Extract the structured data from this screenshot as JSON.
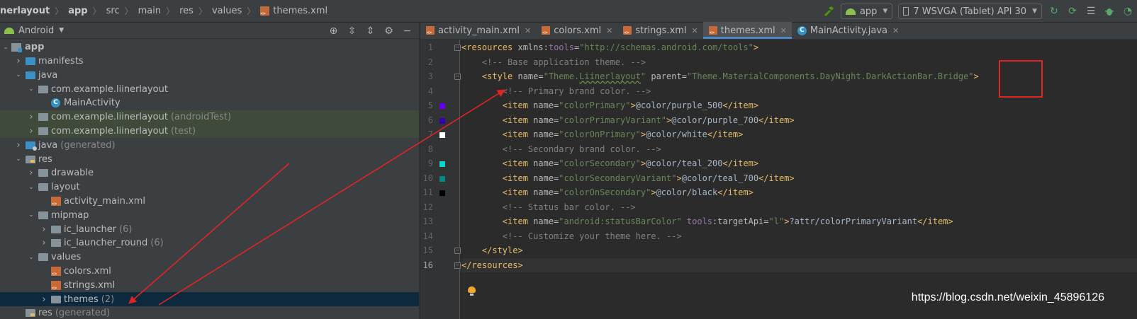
{
  "breadcrumb": [
    "nerlayout",
    "app",
    "src",
    "main",
    "res",
    "values",
    "themes.xml"
  ],
  "toolbar": {
    "config_label": "app",
    "device_label": "7  WSVGA (Tablet) API 30",
    "colors": {
      "hammer": "#4e9a06",
      "android": "#8cbf4d",
      "debug": "#59a869"
    }
  },
  "project": {
    "view_label": "Android",
    "tree": [
      {
        "label": "app",
        "extra": "",
        "depth": 0,
        "arrow": "open",
        "icon": "app",
        "bold": true
      },
      {
        "label": "manifests",
        "extra": "",
        "depth": 1,
        "arrow": "closed",
        "icon": "folder-blue"
      },
      {
        "label": "java",
        "extra": "",
        "depth": 1,
        "arrow": "open",
        "icon": "folder-blue"
      },
      {
        "label": "com.example.liinerlayout",
        "extra": "",
        "depth": 2,
        "arrow": "open",
        "icon": "pkg"
      },
      {
        "label": "MainActivity",
        "extra": "",
        "depth": 3,
        "arrow": "none",
        "icon": "class"
      },
      {
        "label": "com.example.liinerlayout",
        "extra": "(androidTest)",
        "depth": 2,
        "arrow": "closed",
        "icon": "pkg",
        "row": "hl-green"
      },
      {
        "label": "com.example.liinerlayout",
        "extra": "(test)",
        "depth": 2,
        "arrow": "closed",
        "icon": "pkg",
        "row": "hl-green"
      },
      {
        "label": "java",
        "extra": "(generated)",
        "depth": 1,
        "arrow": "closed",
        "icon": "folder-gen"
      },
      {
        "label": "res",
        "extra": "",
        "depth": 1,
        "arrow": "open",
        "icon": "res"
      },
      {
        "label": "drawable",
        "extra": "",
        "depth": 2,
        "arrow": "closed",
        "icon": "pkg"
      },
      {
        "label": "layout",
        "extra": "",
        "depth": 2,
        "arrow": "open",
        "icon": "pkg"
      },
      {
        "label": "activity_main.xml",
        "extra": "",
        "depth": 3,
        "arrow": "none",
        "icon": "xml"
      },
      {
        "label": "mipmap",
        "extra": "",
        "depth": 2,
        "arrow": "open",
        "icon": "pkg"
      },
      {
        "label": "ic_launcher",
        "extra": "(6)",
        "depth": 3,
        "arrow": "closed",
        "icon": "pkg"
      },
      {
        "label": "ic_launcher_round",
        "extra": "(6)",
        "depth": 3,
        "arrow": "closed",
        "icon": "pkg"
      },
      {
        "label": "values",
        "extra": "",
        "depth": 2,
        "arrow": "open",
        "icon": "pkg"
      },
      {
        "label": "colors.xml",
        "extra": "",
        "depth": 3,
        "arrow": "none",
        "icon": "xml"
      },
      {
        "label": "strings.xml",
        "extra": "",
        "depth": 3,
        "arrow": "none",
        "icon": "xml"
      },
      {
        "label": "themes",
        "extra": "(2)",
        "depth": 3,
        "arrow": "closed",
        "icon": "pkg",
        "row": "sel"
      },
      {
        "label": "res",
        "extra": "(generated)",
        "depth": 1,
        "arrow": "none",
        "icon": "res"
      }
    ]
  },
  "editor": {
    "tabs": [
      {
        "label": "activity_main.xml",
        "icon": "xml",
        "active": false
      },
      {
        "label": "colors.xml",
        "icon": "xml",
        "active": false
      },
      {
        "label": "strings.xml",
        "icon": "xml",
        "active": false
      },
      {
        "label": "themes.xml",
        "icon": "xml",
        "active": true
      },
      {
        "label": "MainActivity.java",
        "icon": "class",
        "active": false
      }
    ],
    "current_line": 16,
    "swatches": [
      {
        "line": 5,
        "color": "#6200ee"
      },
      {
        "line": 6,
        "color": "#3700b3"
      },
      {
        "line": 7,
        "color": "#ffffff"
      },
      {
        "line": 9,
        "color": "#03dac5"
      },
      {
        "line": 10,
        "color": "#018786"
      },
      {
        "line": 11,
        "color": "#000000"
      }
    ],
    "lines": [
      [
        [
          "t-tag",
          "<resources "
        ],
        [
          "t-attr",
          "xmlns:"
        ],
        [
          "t-ns",
          "tools"
        ],
        [
          "t-attr",
          "="
        ],
        [
          "t-val",
          "\"http://schemas.android.com/tools\""
        ],
        [
          "t-tag",
          ">"
        ]
      ],
      [
        [
          "t-txt",
          "    "
        ],
        [
          "t-com",
          "<!-- Base application theme. -->"
        ]
      ],
      [
        [
          "t-txt",
          "    "
        ],
        [
          "t-tag",
          "<style "
        ],
        [
          "t-attr",
          "name="
        ],
        [
          "t-val",
          "\"Theme."
        ],
        [
          "t-val t-warn",
          "Liinerlayout"
        ],
        [
          "t-val",
          "\" "
        ],
        [
          "t-attr",
          "parent="
        ],
        [
          "t-val",
          "\"Theme.MaterialComponents.DayNight.DarkActionBar.Bridge\""
        ],
        [
          "t-tag",
          ">"
        ]
      ],
      [
        [
          "t-txt",
          "        "
        ],
        [
          "t-com",
          "<!-- Primary brand color. -->"
        ]
      ],
      [
        [
          "t-txt",
          "        "
        ],
        [
          "t-tag",
          "<item "
        ],
        [
          "t-attr",
          "name="
        ],
        [
          "t-val",
          "\"colorPrimary\""
        ],
        [
          "t-tag",
          ">"
        ],
        [
          "t-txt",
          "@color/purple_500"
        ],
        [
          "t-tag",
          "</item>"
        ]
      ],
      [
        [
          "t-txt",
          "        "
        ],
        [
          "t-tag",
          "<item "
        ],
        [
          "t-attr",
          "name="
        ],
        [
          "t-val",
          "\"colorPrimaryVariant\""
        ],
        [
          "t-tag",
          ">"
        ],
        [
          "t-txt",
          "@color/purple_700"
        ],
        [
          "t-tag",
          "</item>"
        ]
      ],
      [
        [
          "t-txt",
          "        "
        ],
        [
          "t-tag",
          "<item "
        ],
        [
          "t-attr",
          "name="
        ],
        [
          "t-val",
          "\"colorOnPrimary\""
        ],
        [
          "t-tag",
          ">"
        ],
        [
          "t-txt",
          "@color/white"
        ],
        [
          "t-tag",
          "</item>"
        ]
      ],
      [
        [
          "t-txt",
          "        "
        ],
        [
          "t-com",
          "<!-- Secondary brand color. -->"
        ]
      ],
      [
        [
          "t-txt",
          "        "
        ],
        [
          "t-tag",
          "<item "
        ],
        [
          "t-attr",
          "name="
        ],
        [
          "t-val",
          "\"colorSecondary\""
        ],
        [
          "t-tag",
          ">"
        ],
        [
          "t-txt",
          "@color/teal_200"
        ],
        [
          "t-tag",
          "</item>"
        ]
      ],
      [
        [
          "t-txt",
          "        "
        ],
        [
          "t-tag",
          "<item "
        ],
        [
          "t-attr",
          "name="
        ],
        [
          "t-val",
          "\"colorSecondaryVariant\""
        ],
        [
          "t-tag",
          ">"
        ],
        [
          "t-txt",
          "@color/teal_700"
        ],
        [
          "t-tag",
          "</item>"
        ]
      ],
      [
        [
          "t-txt",
          "        "
        ],
        [
          "t-tag",
          "<item "
        ],
        [
          "t-attr",
          "name="
        ],
        [
          "t-val",
          "\"colorOnSecondary\""
        ],
        [
          "t-tag",
          ">"
        ],
        [
          "t-txt",
          "@color/black"
        ],
        [
          "t-tag",
          "</item>"
        ]
      ],
      [
        [
          "t-txt",
          "        "
        ],
        [
          "t-com",
          "<!-- Status bar color. -->"
        ]
      ],
      [
        [
          "t-txt",
          "        "
        ],
        [
          "t-tag",
          "<item "
        ],
        [
          "t-attr",
          "name="
        ],
        [
          "t-val",
          "\"android:statusBarColor\" "
        ],
        [
          "t-ns",
          "tools"
        ],
        [
          "t-attr",
          ":targetApi="
        ],
        [
          "t-val",
          "\"l\""
        ],
        [
          "t-tag",
          ">"
        ],
        [
          "t-txt",
          "?attr/colorPrimaryVariant"
        ],
        [
          "t-tag",
          "</item>"
        ]
      ],
      [
        [
          "t-txt",
          "        "
        ],
        [
          "t-com",
          "<!-- Customize your theme here. -->"
        ]
      ],
      [
        [
          "t-txt",
          "    "
        ],
        [
          "t-tag",
          "</style>"
        ]
      ],
      [
        [
          "t-tag",
          "</resources>"
        ]
      ]
    ]
  },
  "annotations": {
    "color": "#e02424"
  },
  "watermark": "https://blog.csdn.net/weixin_45896126"
}
